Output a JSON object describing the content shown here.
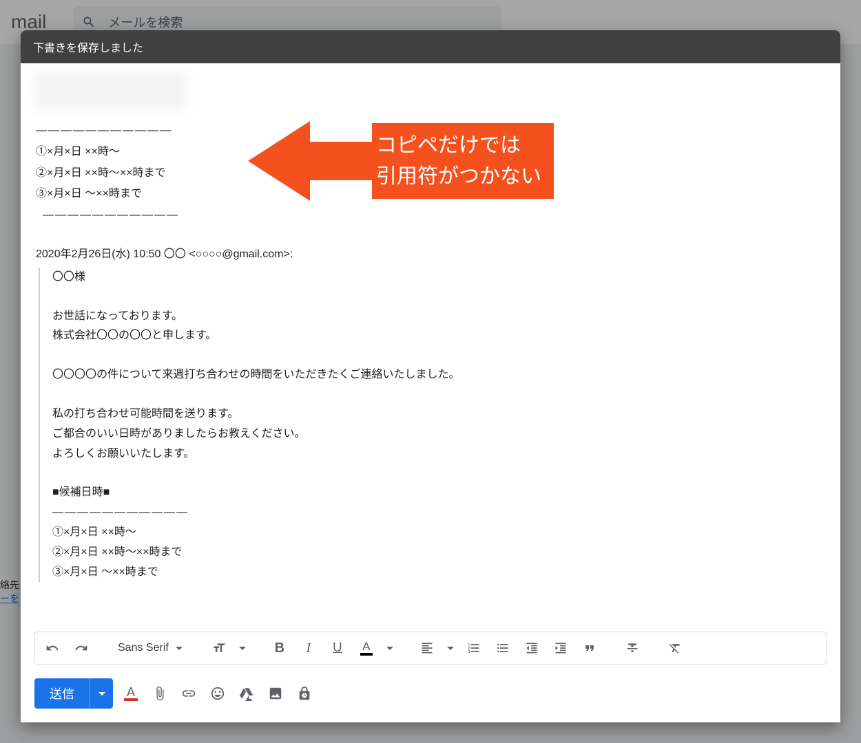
{
  "bg": {
    "logo": "mail",
    "search_placeholder": "メールを検索",
    "sidebar_text": "絡先",
    "sidebar_link": "ーを"
  },
  "header": {
    "title": "下書きを保存しました"
  },
  "body": {
    "dash1": "―――――――――――",
    "s1": "①×月×日 ××時～",
    "s2": "②×月×日 ××時～××時まで",
    "s3": "③×月×日 ～××時まで",
    "dash2": " ―――――――――――",
    "attribution": "2020年2月26日(水) 10:50 〇〇 <○○○○@gmail.com>:",
    "quote": {
      "l1": "〇〇様",
      "l2": "お世話になっております。",
      "l3": "株式会社〇〇の〇〇と申します。",
      "l4": "〇〇〇〇の件について来週打ち合わせの時間をいただきたくご連絡いたしました。",
      "l5": "私の打ち合わせ可能時間を送ります。",
      "l6": "ご都合のいい日時がありましたらお教えください。",
      "l7": "よろしくお願いいたします。",
      "l8": "■候補日時■",
      "l9": "―――――――――――",
      "l10": "①×月×日 ××時～",
      "l11": "②×月×日 ××時～××時まで",
      "l12": "③×月×日 ～××時まで"
    }
  },
  "annotation": {
    "line1": "コピペだけでは",
    "line2": "引用符がつかない"
  },
  "toolbar": {
    "font": "Sans Serif"
  },
  "send": {
    "label": "送信"
  }
}
